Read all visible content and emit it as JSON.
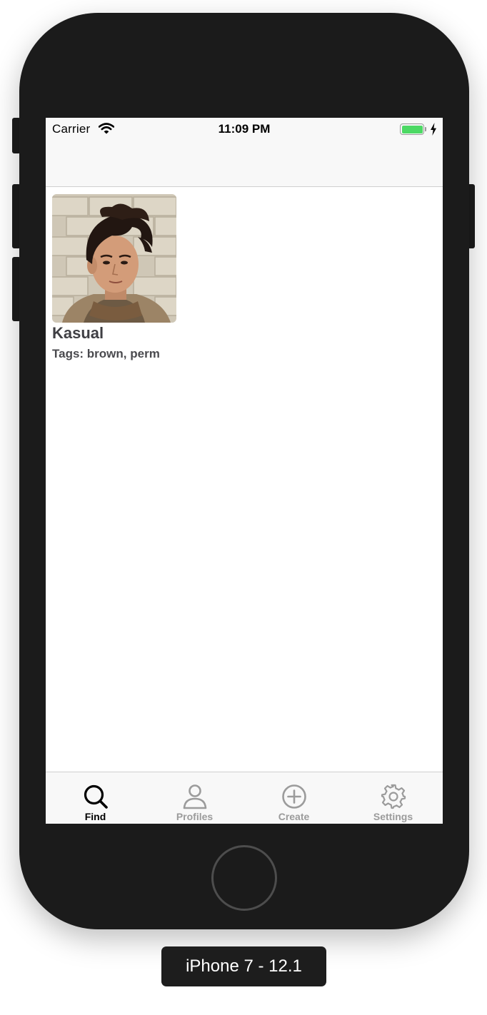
{
  "device": {
    "label": "iPhone 7 - 12.1"
  },
  "status_bar": {
    "carrier": "Carrier",
    "wifi_icon": "wifi-icon",
    "time": "11:09 PM",
    "battery_icon": "battery-icon",
    "battery_level": 1.0,
    "charging_icon": "charging-bolt-icon",
    "battery_color": "#4cd964"
  },
  "profiles": [
    {
      "name": "Kasual",
      "tags": "Tags: brown, perm",
      "photo": "profile-photo"
    }
  ],
  "tab_bar": {
    "active_index": 0,
    "active_color": "#000000",
    "inactive_color": "#9b9b9b",
    "tabs": [
      {
        "label": "Find",
        "icon": "search-icon"
      },
      {
        "label": "Profiles",
        "icon": "person-icon"
      },
      {
        "label": "Create",
        "icon": "plus-circle-icon"
      },
      {
        "label": "Settings",
        "icon": "gear-icon"
      }
    ]
  }
}
